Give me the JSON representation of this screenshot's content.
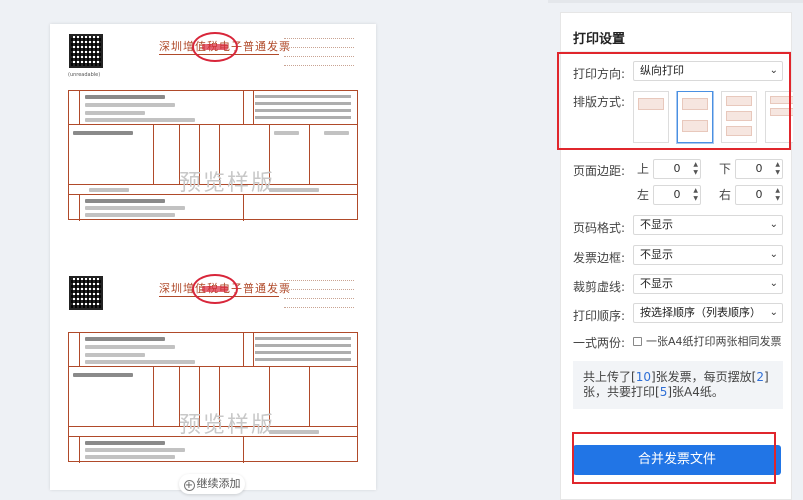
{
  "preview": {
    "invoice_title": "深圳增值税电子普通发票",
    "watermark": "预览样版",
    "add_more_label": "继续添加"
  },
  "settings": {
    "title": "打印设置",
    "orientation": {
      "label": "打印方向:",
      "value": "纵向打印"
    },
    "layout": {
      "label": "排版方式:"
    },
    "margins": {
      "label": "页面边距:",
      "top": {
        "label": "上",
        "value": "0"
      },
      "bottom": {
        "label": "下",
        "value": "0"
      },
      "left": {
        "label": "左",
        "value": "0"
      },
      "right": {
        "label": "右",
        "value": "0"
      }
    },
    "page_number": {
      "label": "页码格式:",
      "value": "不显示"
    },
    "invoice_border": {
      "label": "发票边框:",
      "value": "不显示"
    },
    "crop_line": {
      "label": "裁剪虚线:",
      "value": "不显示"
    },
    "print_order": {
      "label": "打印顺序:",
      "value": "按选择顺序（列表顺序）"
    },
    "duplicate": {
      "label": "一式两份:",
      "checkbox_label": "一张A4纸打印两张相同发票"
    },
    "summary": {
      "prefix": "共上传了[",
      "uploaded": "10",
      "mid1": "]张发票，每页摆放[",
      "per_page": "2",
      "mid2": "]张，共要打印[",
      "pages": "5",
      "suffix": "]张A4纸。"
    },
    "merge_button": "合并发票文件"
  },
  "colors": {
    "accent": "#2175e6",
    "highlight": "#e0262c",
    "invoice": "#b04a2a"
  }
}
